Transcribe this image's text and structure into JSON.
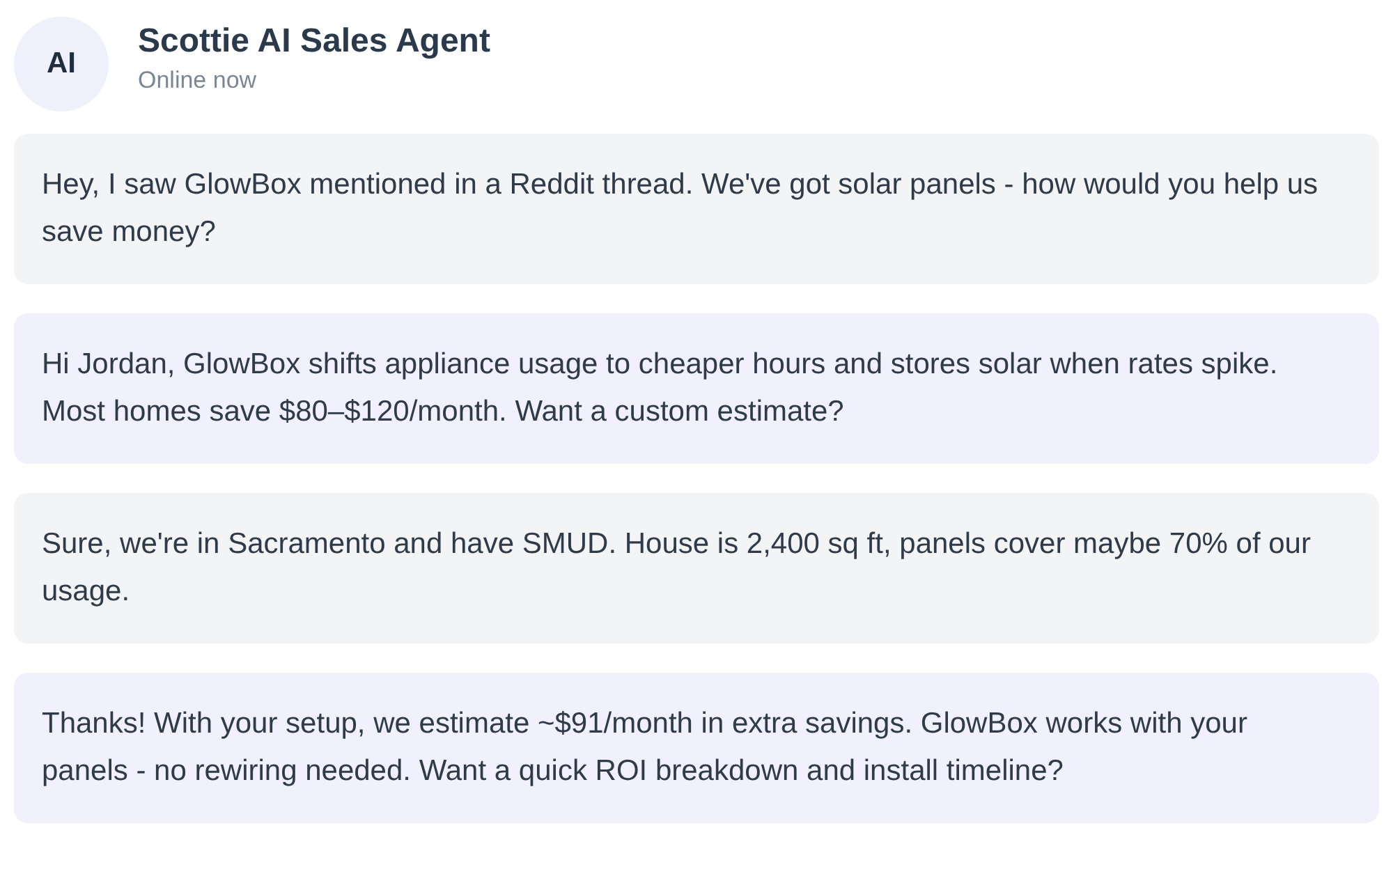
{
  "header": {
    "avatar": "AI",
    "title": "Scottie AI Sales Agent",
    "status": "Online now"
  },
  "messages": [
    {
      "kind": "customer",
      "text": "Hey, I saw GlowBox mentioned in a Reddit thread. We've got solar panels - how would you help us save money?"
    },
    {
      "kind": "agent",
      "text": "Hi Jordan, GlowBox shifts appliance usage to cheaper hours and stores solar when rates spike. Most homes save $80–$120/month. Want a custom estimate?"
    },
    {
      "kind": "customer",
      "text": "Sure, we're in Sacramento and have SMUD. House is 2,400 sq ft, panels cover maybe 70% of our usage."
    },
    {
      "kind": "agent",
      "text": "Thanks! With your setup, we estimate ~$91/month in extra savings. GlowBox works with your panels - no rewiring needed. Want a quick ROI breakdown and install timeline?"
    }
  ]
}
